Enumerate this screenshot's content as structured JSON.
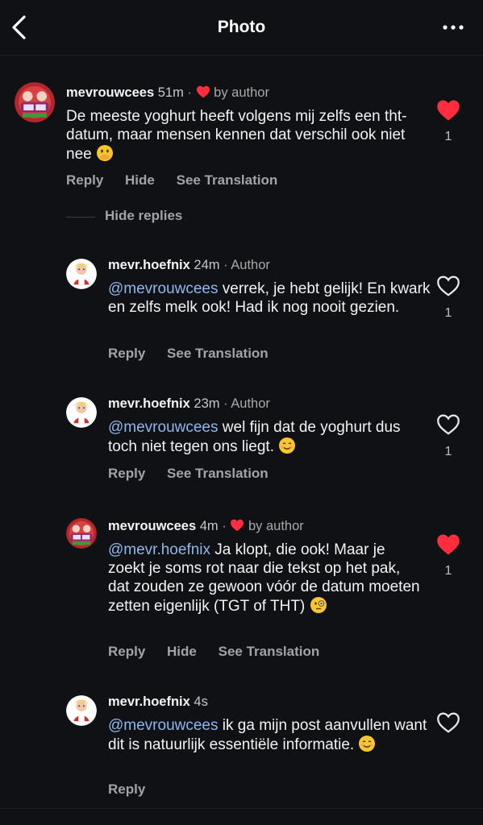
{
  "header": {
    "title": "Photo",
    "back_icon": "chevron-left-icon",
    "menu_icon": "more-horizontal-icon"
  },
  "comments": [
    {
      "user": "mevrouwcees",
      "time": "51m",
      "badge": "by author",
      "text": "De meeste yoghurt heeft volgens mij zelfs een tht-datum, maar mensen kennen dat verschil ook niet nee",
      "emoji": "face-with-hand-over-mouth",
      "actions": [
        "Reply",
        "Hide",
        "See Translation"
      ],
      "liked": true,
      "likes": "1"
    }
  ],
  "hide_replies_label": "Hide replies",
  "replies": [
    {
      "user": "mevr.hoefnix",
      "time": "24m",
      "badge": "Author",
      "mention": "@mevrouwcees",
      "text": " verrek, je hebt gelijk! En kwark en zelfs melk ook! Had ik nog nooit gezien.",
      "actions": [
        "Reply",
        "See Translation"
      ],
      "liked": false,
      "likes": "1"
    },
    {
      "user": "mevr.hoefnix",
      "time": "23m",
      "badge": "Author",
      "mention": "@mevrouwcees",
      "text": " wel fijn dat de yoghurt dus toch niet tegen ons liegt.",
      "emoji": "smiling-face",
      "actions": [
        "Reply",
        "See Translation"
      ],
      "liked": false,
      "likes": "1"
    },
    {
      "user": "mevrouwcees",
      "time": "4m",
      "badge": "by author",
      "mention": "@mevr.hoefnix",
      "text": " Ja klopt, die ook! Maar je zoekt je soms rot naar die tekst op het pak, dat zouden ze gewoon vóór de datum moeten zetten eigenlijk (TGT of THT)",
      "emoji": "face-with-monocle",
      "actions": [
        "Reply",
        "Hide",
        "See Translation"
      ],
      "liked": true,
      "likes": "1"
    },
    {
      "user": "mevr.hoefnix",
      "time": "4s",
      "badge": "",
      "mention": "@mevrouwcees",
      "text": " ik ga mijn post aanvullen want dit is natuurlijk essentiële informatie.",
      "emoji": "smiling-face",
      "actions": [
        "Reply"
      ],
      "liked": false,
      "likes": ""
    }
  ],
  "colors": {
    "background": "#0f1115",
    "heart": "#ff2d3d",
    "mention": "#8fb7ea",
    "muted": "#a0a4a8"
  }
}
